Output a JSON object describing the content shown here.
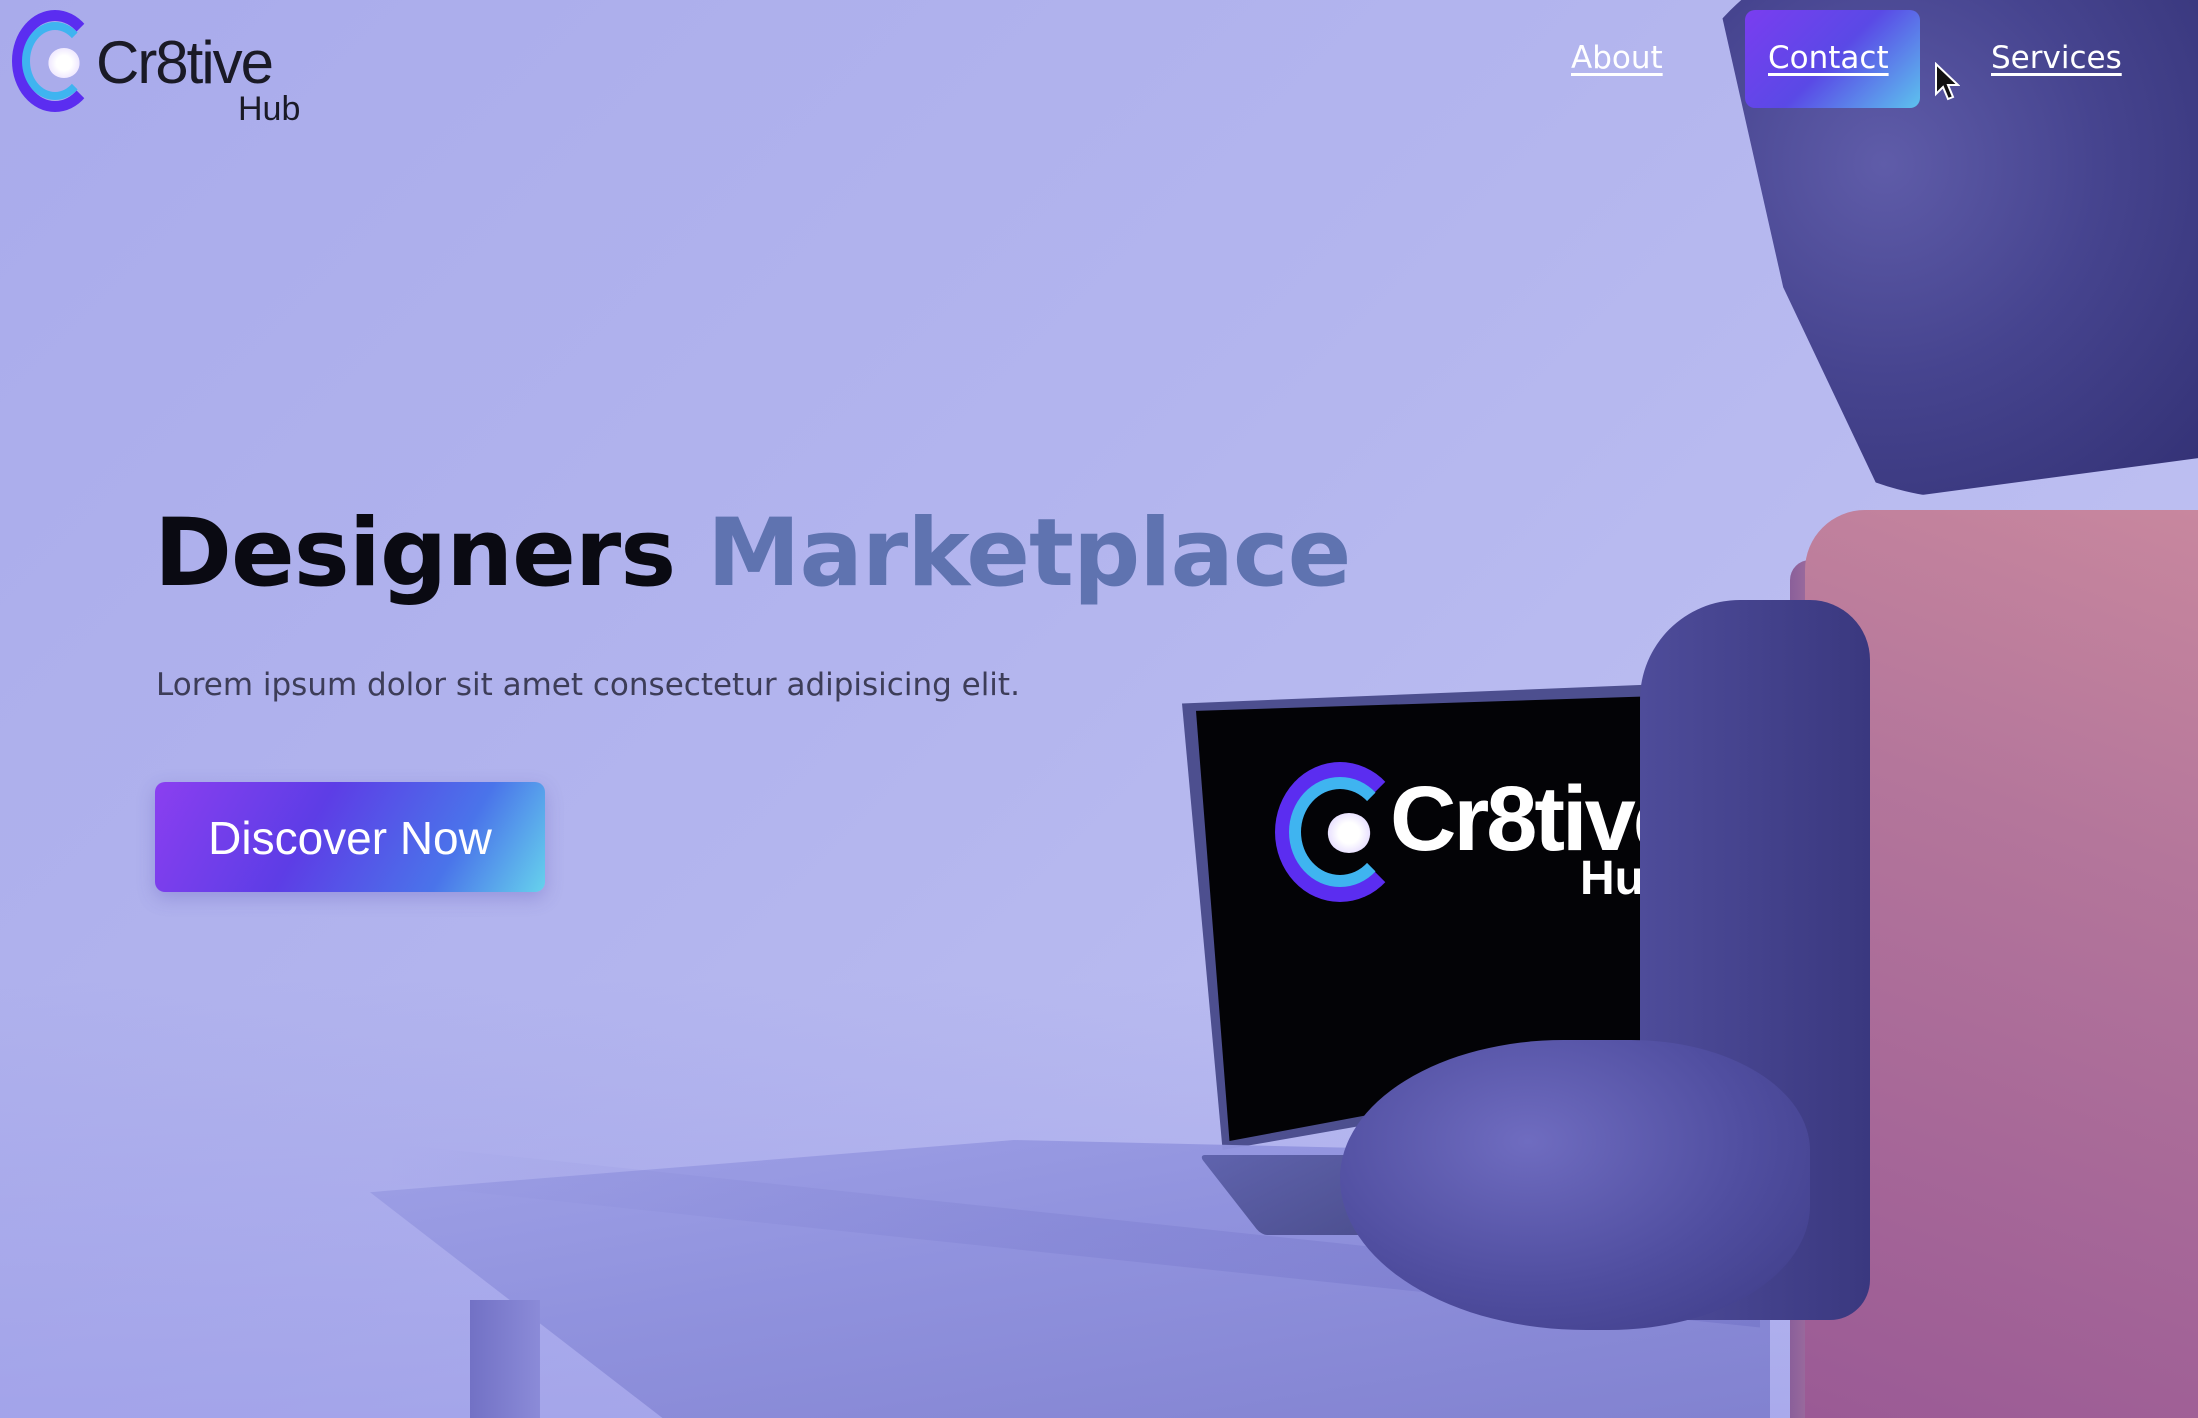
{
  "brand": {
    "name": "Cr8tive",
    "sub": "Hub"
  },
  "nav": {
    "about": "About",
    "contact": "Contact",
    "services": "Services"
  },
  "hero": {
    "title_part1": "Designers",
    "title_part2": "Marketplace",
    "subtitle": "Lorem ipsum dolor sit amet consectetur adipisicing elit.",
    "cta_label": "Discover Now"
  },
  "screen_logo": {
    "name": "Cr8tive",
    "sub": "Hub"
  },
  "colors": {
    "accent_purple": "#7a3df0",
    "accent_cyan": "#5dc2ee",
    "title_accent": "#5f73b0",
    "background": "#b3b5ee"
  }
}
